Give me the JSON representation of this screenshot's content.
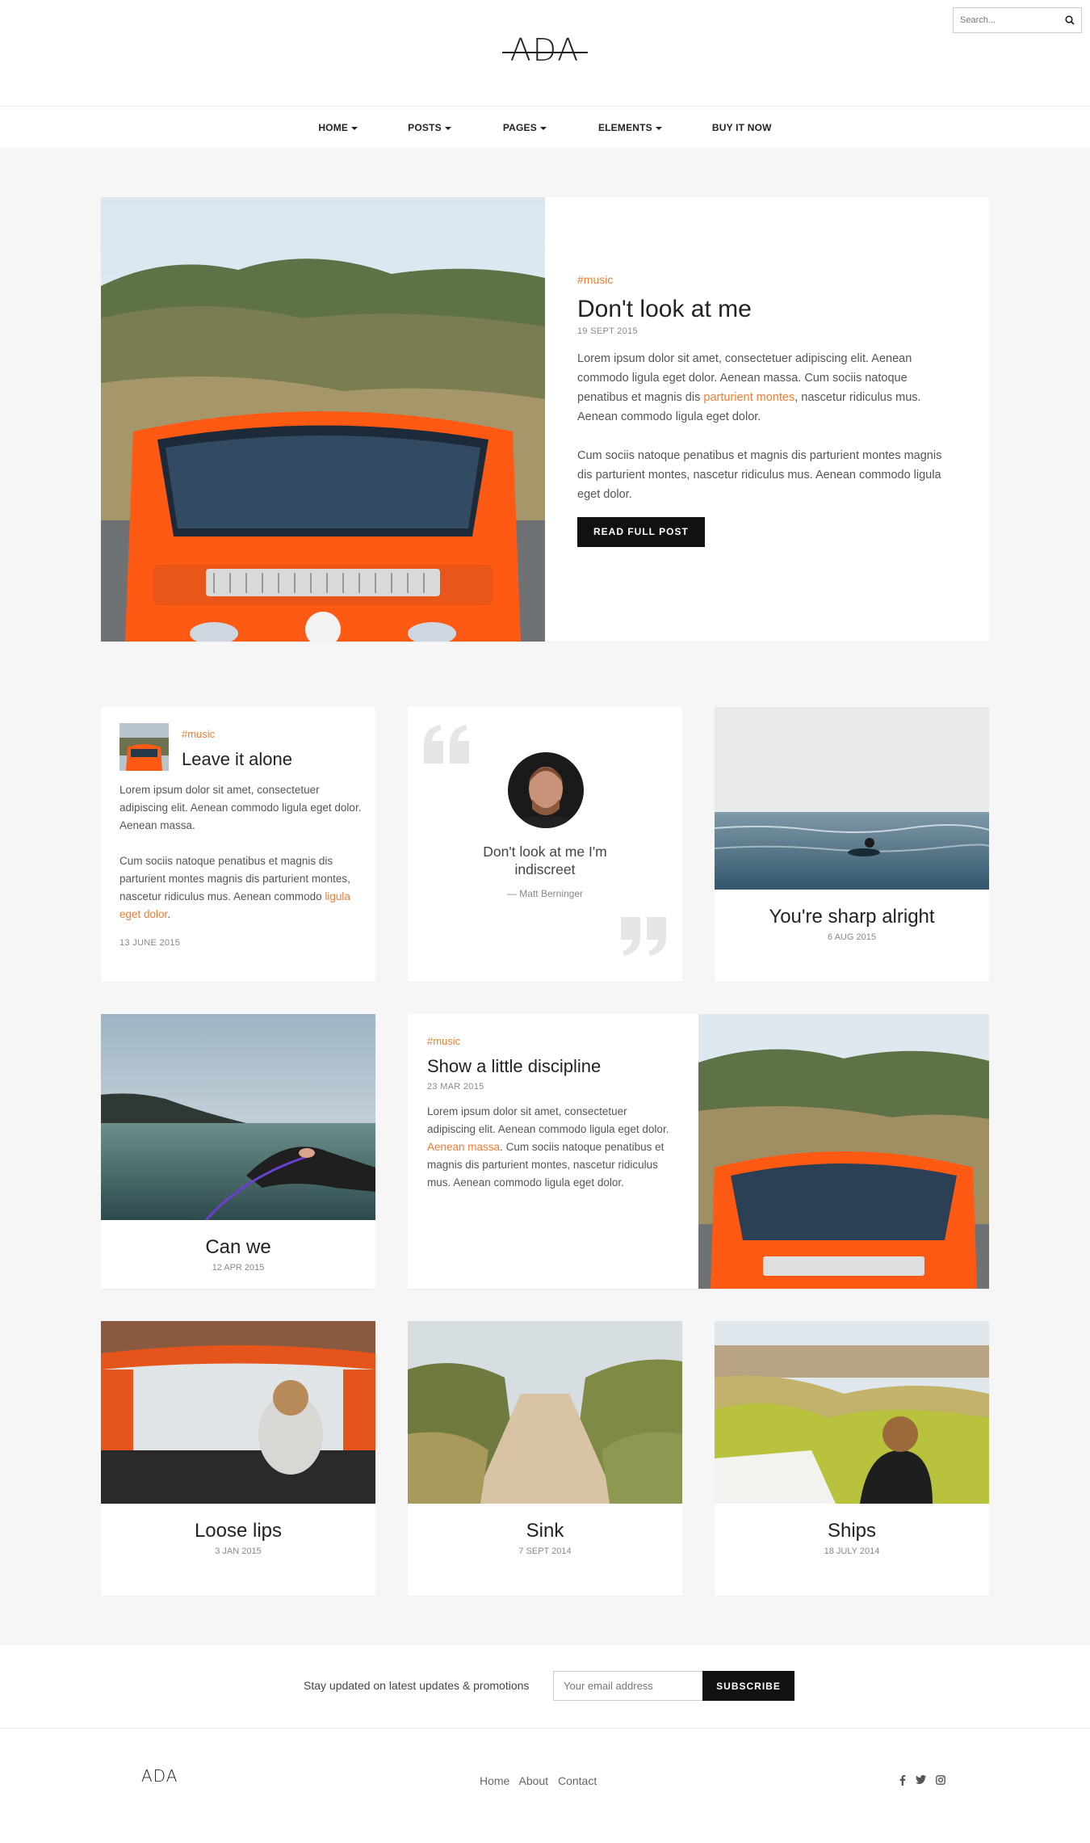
{
  "header": {
    "logo": "ADA",
    "search_placeholder": "Search..."
  },
  "nav": {
    "items": [
      {
        "label": "HOME",
        "dropdown": true
      },
      {
        "label": "POSTS",
        "dropdown": true
      },
      {
        "label": "PAGES",
        "dropdown": true
      },
      {
        "label": "ELEMENTS",
        "dropdown": true
      },
      {
        "label": "BUY IT NOW",
        "dropdown": false
      }
    ]
  },
  "featured": {
    "tag": "#music",
    "title": "Don't look at me",
    "date": "19 SEPT 2015",
    "para1_a": "Lorem ipsum dolor sit amet, consectetuer adipiscing elit. Aenean commodo ligula eget dolor. Aenean massa. Cum sociis natoque penatibus et magnis dis ",
    "para1_link": "parturient montes",
    "para1_b": ", nascetur ridiculus mus. Aenean commodo ligula eget dolor.",
    "para2": "Cum sociis natoque penatibus et magnis dis parturient montes magnis dis parturient montes, nascetur ridiculus mus. Aenean commodo ligula eget dolor.",
    "button": "READ FULL POST"
  },
  "card_leave": {
    "tag": "#music",
    "title": "Leave it alone",
    "para1": "Lorem ipsum dolor sit amet, consectetuer adipiscing elit. Aenean commodo ligula eget dolor. Aenean massa.",
    "para2_a": "Cum sociis natoque penatibus et magnis dis parturient montes magnis dis parturient montes, nascetur ridiculus mus. Aenean commodo ",
    "para2_link": "ligula eget dolor",
    "para2_b": ".",
    "date": "13 JUNE 2015"
  },
  "card_quote": {
    "quote": "Don't look at me I'm indiscreet",
    "author": "— Matt Berninger"
  },
  "card_sharp": {
    "title": "You're sharp alright",
    "date": "6 AUG 2015"
  },
  "card_canwe": {
    "title": "Can we",
    "date": "12 APR 2015"
  },
  "card_discipline": {
    "tag": "#music",
    "title": "Show a little discipline",
    "date": "23 MAR 2015",
    "text_a": "Lorem ipsum dolor sit amet, consectetuer adipiscing elit. Aenean commodo ligula eget dolor. ",
    "text_link": "Aenean massa",
    "text_b": ". Cum sociis natoque penatibus et magnis dis parturient montes, nascetur ridiculus mus. Aenean commodo ligula eget dolor."
  },
  "card_loose": {
    "title": "Loose lips",
    "date": "3 JAN 2015"
  },
  "card_sink": {
    "title": "Sink",
    "date": "7 SEPT 2014"
  },
  "card_ships": {
    "title": "Ships",
    "date": "18 JULY 2014"
  },
  "subscribe": {
    "text": "Stay updated on latest updates & promotions",
    "placeholder": "Your email address",
    "button": "SUBSCRIBE"
  },
  "footer": {
    "logo": "ADA",
    "links": [
      "Home",
      "About",
      "Contact"
    ],
    "social": [
      "facebook-icon",
      "twitter-icon",
      "instagram-icon"
    ]
  },
  "colors": {
    "accent": "#f07c34",
    "dark": "#111111",
    "bg": "#f6f6f6"
  }
}
